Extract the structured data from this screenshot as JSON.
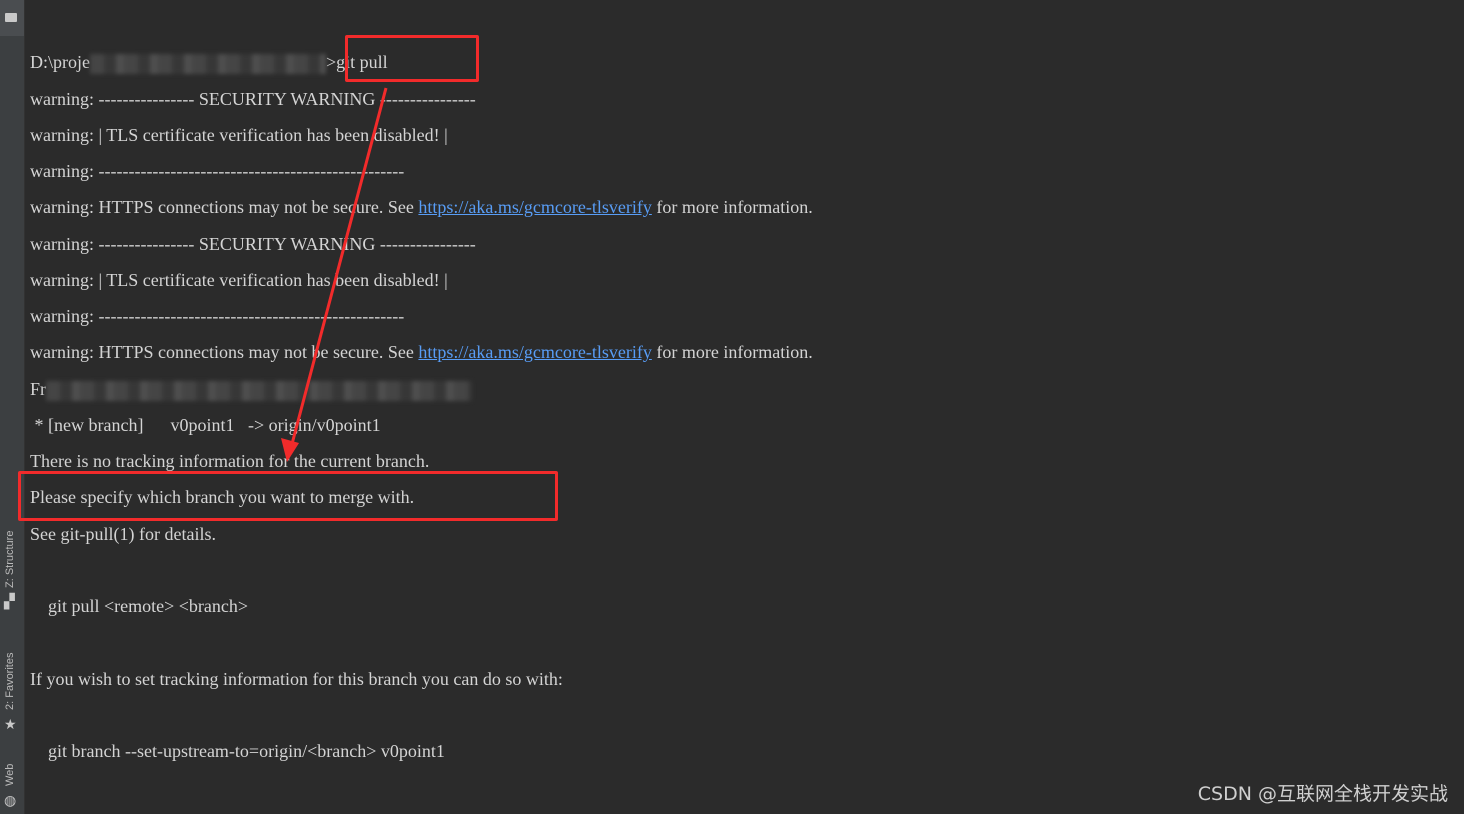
{
  "sidebar": {
    "top_number": "1",
    "tabs": [
      {
        "label": "Z: Structure",
        "icon": "structure-icon"
      },
      {
        "label": "2: Favorites",
        "icon": "star-icon"
      },
      {
        "label": "Web",
        "icon": "globe-icon"
      }
    ]
  },
  "terminal": {
    "prompt_prefix": "D:\\proje",
    "command": ">git pull",
    "lines": {
      "l1": "warning: ---------------- SECURITY WARNING ----------------",
      "l2": "warning: | TLS certificate verification has been disabled! |",
      "l3": "warning: ---------------------------------------------------",
      "l4_pre": "warning: HTTPS connections may not be secure. See ",
      "l4_link": "https://aka.ms/gcmcore-tlsverify",
      "l4_post": " for more information.",
      "l5": "warning: ---------------- SECURITY WARNING ----------------",
      "l6": "warning: | TLS certificate verification has been disabled! |",
      "l7": "warning: ---------------------------------------------------",
      "l8_pre": "warning: HTTPS connections may not be secure. See ",
      "l8_link": "https://aka.ms/gcmcore-tlsverify",
      "l8_post": " for more information.",
      "l9": "Fr",
      "l10": " * [new branch]      v0point1   -> origin/v0point1",
      "l11": "There is no tracking information for the current branch.",
      "l12": "Please specify which branch you want to merge with.",
      "l13": "See git-pull(1) for details.",
      "l14": "    git pull <remote> <branch>",
      "l15": "If you wish to set tracking information for this branch you can do so with:",
      "l16": "    git branch --set-upstream-to=origin/<branch> v0point1"
    }
  },
  "annotation_color": "#f22b2b",
  "watermark": "CSDN @互联网全栈开发实战"
}
